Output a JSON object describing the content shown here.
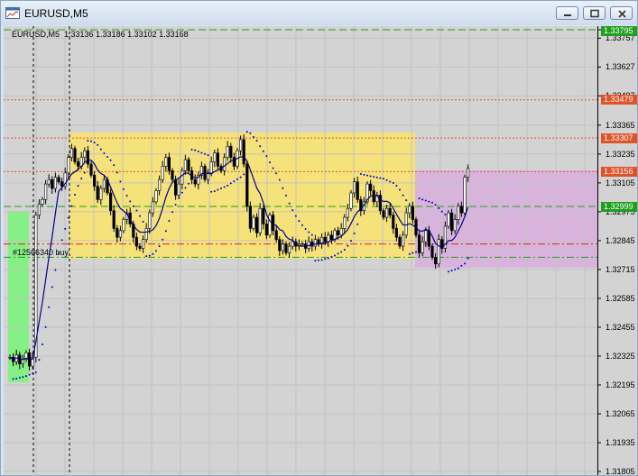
{
  "window": {
    "title": "EURUSD,M5",
    "buttons": [
      "minimize-icon",
      "maximize-icon",
      "close-icon"
    ]
  },
  "chart": {
    "symbol_info": "EURUSD,M5  1.33136 1.33186 1.33102 1.33168",
    "order_label": "#12566340 buy",
    "price_scale": [
      "1.33795",
      "1.33757",
      "1.33627",
      "1.33497",
      "1.33365",
      "1.33235",
      "1.33105",
      "1.32975",
      "1.32845",
      "1.32715",
      "1.32585",
      "1.32455",
      "1.32325",
      "1.32195",
      "1.32065",
      "1.31935",
      "1.31805"
    ],
    "price_tags": [
      {
        "text": "1.33795",
        "color": "#1f9e1f"
      },
      {
        "text": "1.33479",
        "color": "#e0522a"
      },
      {
        "text": "1.33307",
        "color": "#e0522a"
      },
      {
        "text": "1.33156",
        "color": "#e0522a"
      },
      {
        "text": "1.32999",
        "color": "#1f9e1f"
      }
    ]
  },
  "colors": {
    "chart_bg": "#d3d3d3",
    "range_box": "#f5e27a",
    "buy_box": "#d8b4dc",
    "green_box": "#86f086",
    "candles": "#000000",
    "sar_dots": "#0000c8",
    "moving_average": "#00008b",
    "stop_line": "#e02020",
    "target_line": "#1f9e1f"
  },
  "chart_data": {
    "type": "candlestick",
    "title": "EURUSD,M5",
    "last_bar": {
      "open": 1.33136,
      "high": 1.33186,
      "low": 1.33102,
      "close": 1.33168
    },
    "ylim": [
      1.31805,
      1.33795
    ],
    "y_ticks": [
      1.33757,
      1.33627,
      1.33497,
      1.33365,
      1.33235,
      1.33105,
      1.32975,
      1.32845,
      1.32715,
      1.32585,
      1.32455,
      1.32325,
      1.32195,
      1.32065,
      1.31935,
      1.31805
    ],
    "horizontal_lines": [
      {
        "price": 1.33795,
        "color": "#1f9e1f",
        "style": "dashed"
      },
      {
        "price": 1.33479,
        "color": "#e0522a",
        "style": "dotted"
      },
      {
        "price": 1.33307,
        "color": "#e0522a",
        "style": "dotted"
      },
      {
        "price": 1.33156,
        "color": "#e0522a",
        "style": "dotted"
      },
      {
        "price": 1.32999,
        "color": "#1f9e1f",
        "style": "dashed"
      },
      {
        "price": 1.3283,
        "color": "#e02020",
        "style": "dashdot"
      },
      {
        "price": 1.3277,
        "color": "#1f9e1f",
        "style": "dashdot"
      }
    ],
    "closes": [
      1.3232,
      1.323,
      1.3233,
      1.3229,
      1.3231,
      1.3234,
      1.3228,
      1.3232,
      1.3296,
      1.3301,
      1.3303,
      1.331,
      1.3312,
      1.3308,
      1.3313,
      1.3311,
      1.3309,
      1.3315,
      1.3322,
      1.3326,
      1.332,
      1.3318,
      1.3322,
      1.3325,
      1.3319,
      1.3314,
      1.3309,
      1.3303,
      1.3308,
      1.3312,
      1.3306,
      1.3298,
      1.329,
      1.3286,
      1.3289,
      1.3294,
      1.3297,
      1.3292,
      1.3286,
      1.3282,
      1.3281,
      1.3285,
      1.329,
      1.3297,
      1.3302,
      1.3307,
      1.3312,
      1.3318,
      1.3322,
      1.3316,
      1.3312,
      1.3305,
      1.331,
      1.3316,
      1.3321,
      1.3316,
      1.3312,
      1.331,
      1.3314,
      1.3318,
      1.3312,
      1.3315,
      1.332,
      1.3324,
      1.3318,
      1.3316,
      1.3322,
      1.3327,
      1.3322,
      1.3318,
      1.3325,
      1.333,
      1.3319,
      1.33,
      1.329,
      1.3295,
      1.3288,
      1.3299,
      1.3292,
      1.3287,
      1.3296,
      1.3289,
      1.3285,
      1.328,
      1.3283,
      1.3279,
      1.3282,
      1.3284,
      1.3282,
      1.3283,
      1.3283,
      1.3281,
      1.3284,
      1.3282,
      1.3285,
      1.3283,
      1.3286,
      1.3284,
      1.3287,
      1.3285,
      1.3289,
      1.3287,
      1.329,
      1.3295,
      1.3299,
      1.3306,
      1.3311,
      1.3303,
      1.3298,
      1.3302,
      1.331,
      1.3307,
      1.3302,
      1.3305,
      1.3298,
      1.3295,
      1.3299,
      1.3296,
      1.329,
      1.3286,
      1.3282,
      1.3287,
      1.3297,
      1.33,
      1.3294,
      1.3287,
      1.3279,
      1.3284,
      1.3289,
      1.3282,
      1.3277,
      1.3274,
      1.3285,
      1.3281,
      1.3291,
      1.3297,
      1.3289,
      1.3294,
      1.33,
      1.3297,
      1.3313,
      1.3317
    ]
  }
}
